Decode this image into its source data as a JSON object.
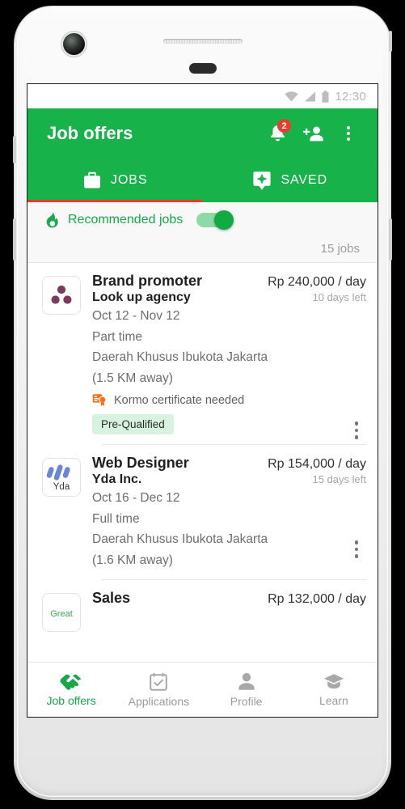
{
  "status_bar": {
    "time": "12:30",
    "icons": [
      "wifi-icon",
      "cellular-signal-icon",
      "battery-icon"
    ]
  },
  "app_bar": {
    "title": "Job offers",
    "notification_badge": "2",
    "icons": [
      "notification-bell-icon",
      "add-person-icon",
      "overflow-menu-icon"
    ],
    "background_color": "#18b24b"
  },
  "tabs": {
    "items": [
      {
        "label": "JOBS",
        "icon": "briefcase-icon",
        "active": true
      },
      {
        "label": "SAVED",
        "icon": "sparkle-bookmark-icon",
        "active": false
      }
    ],
    "indicator_color": "#f4392c"
  },
  "recommended": {
    "label": "Recommended jobs",
    "icon": "flame-icon",
    "toggle_on": true,
    "toggle_color": "#11ab45",
    "job_count": "15 jobs"
  },
  "jobs": [
    {
      "title": "Brand promoter",
      "company": "Look up agency",
      "pay": "Rp 240,000 / day",
      "days_left": "10 days left",
      "dates": "Oct 12 - Nov 12",
      "schedule": "Part time",
      "location": "Daerah Khusus Ibukota Jakarta",
      "distance": "(1.5 KM away)",
      "certificate": "Kormo certificate needed",
      "certificate_icon": "certificate-badge-icon",
      "chip": "Pre-Qualified",
      "logo": {
        "type": "three-dots",
        "color": "#7b3a5e",
        "text": ""
      }
    },
    {
      "title": "Web Designer",
      "company": "Yda Inc.",
      "pay": "Rp 154,000 / day",
      "days_left": "15 days left",
      "dates": "Oct 16 - Dec 12",
      "schedule": "Full time",
      "location": "Daerah Khusus Ibukota Jakarta",
      "distance": "(1.6 KM away)",
      "certificate": "",
      "chip": "",
      "logo": {
        "type": "bars",
        "color": "#6b86d6",
        "text": "Yda"
      }
    },
    {
      "title": "Sales",
      "company": "",
      "pay": "Rp 132,000 / day",
      "days_left": "",
      "dates": "",
      "schedule": "",
      "location": "",
      "distance": "",
      "certificate": "",
      "chip": "",
      "logo": {
        "type": "text",
        "color": "#3aa757",
        "text": "Great"
      }
    }
  ],
  "bottom_nav": {
    "items": [
      {
        "label": "Job offers",
        "icon": "handshake-icon",
        "active": true
      },
      {
        "label": "Applications",
        "icon": "checklist-icon",
        "active": false
      },
      {
        "label": "Profile",
        "icon": "person-icon",
        "active": false
      },
      {
        "label": "Learn",
        "icon": "graduation-cap-icon",
        "active": false
      }
    ],
    "active_color": "#16a84a"
  }
}
